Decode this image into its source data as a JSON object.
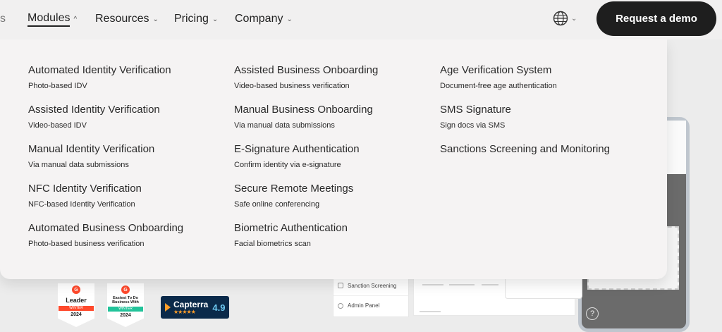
{
  "nav": {
    "stub": "s",
    "items": [
      {
        "label": "Modules",
        "active": true
      },
      {
        "label": "Resources"
      },
      {
        "label": "Pricing"
      },
      {
        "label": "Company"
      }
    ],
    "language_icon": "globe-icon",
    "cta_label": "Request a demo"
  },
  "modules_menu": {
    "columns": [
      [
        {
          "title": "Automated Identity Verification",
          "subtitle": "Photo-based IDV"
        },
        {
          "title": "Assisted Identity Verification",
          "subtitle": "Video-based IDV"
        },
        {
          "title": "Manual Identity Verification",
          "subtitle": "Via manual data submissions"
        },
        {
          "title": "NFC Identity Verification",
          "subtitle": "NFC-based Identity Verification"
        },
        {
          "title": "Automated Business Onboarding",
          "subtitle": "Photo-based business verification"
        }
      ],
      [
        {
          "title": "Assisted Business Onboarding",
          "subtitle": "Video-based business verification"
        },
        {
          "title": "Manual Business Onboarding",
          "subtitle": "Via manual data submissions"
        },
        {
          "title": "E-Signature Authentication",
          "subtitle": "Confirm identity via e-signature"
        },
        {
          "title": "Secure Remote Meetings",
          "subtitle": "Safe online conferencing"
        },
        {
          "title": "Biometric Authentication",
          "subtitle": "Facial biometrics scan"
        }
      ],
      [
        {
          "title": "Age Verification System",
          "subtitle": "Document-free age authentication"
        },
        {
          "title": "SMS Signature",
          "subtitle": "Sign docs via SMS"
        },
        {
          "title": "Sanctions Screening and Monitoring",
          "subtitle": ""
        }
      ]
    ]
  },
  "background": {
    "admin_rows": [
      "Sanction Screening",
      "Admin Panel"
    ],
    "help_glyph": "?",
    "badges": [
      {
        "logo": "G",
        "title": "Leader",
        "ribbon": "WINTER",
        "year": "2024",
        "ribbon_color": "#ff492c"
      },
      {
        "logo": "G",
        "title": "Easiest To Do Business With",
        "ribbon": "WINTER",
        "year": "2024",
        "ribbon_color": "#22c39a"
      }
    ],
    "capterra": {
      "name": "Capterra",
      "stars": "★★★★★",
      "score": "4.9"
    }
  },
  "colors": {
    "cta_bg": "#1e1e1e",
    "dropdown_bg": "#f5f3f3",
    "page_bg": "#eeeded"
  }
}
